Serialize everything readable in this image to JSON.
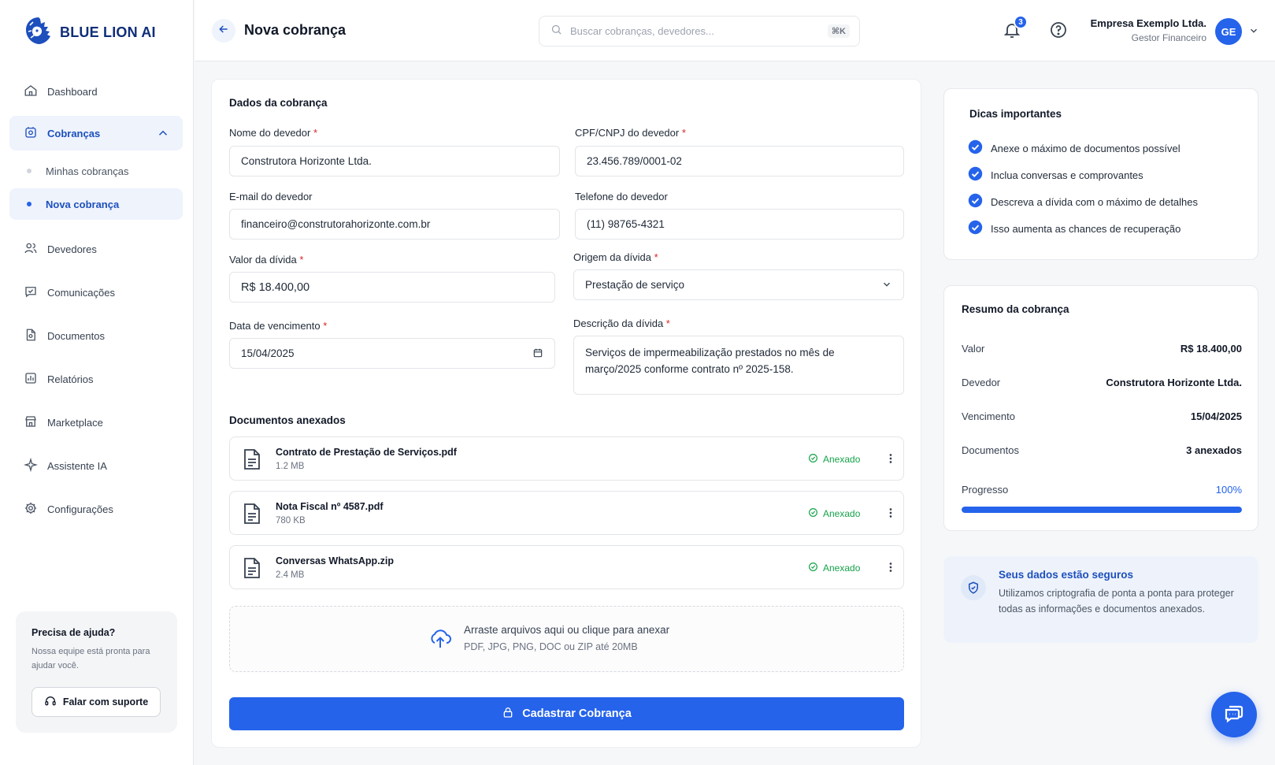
{
  "brand": {
    "name": "BLUE LION AI"
  },
  "sidebar": {
    "items": [
      {
        "label": "Dashboard"
      },
      {
        "label": "Cobranças"
      },
      {
        "label": "Devedores"
      },
      {
        "label": "Comunicações"
      },
      {
        "label": "Documentos"
      },
      {
        "label": "Relatórios"
      },
      {
        "label": "Marketplace"
      },
      {
        "label": "Assistente IA"
      },
      {
        "label": "Configurações"
      }
    ],
    "subitems": [
      {
        "label": "Minhas cobranças"
      },
      {
        "label": "Nova cobrança"
      }
    ],
    "help": {
      "title": "Precisa de ajuda?",
      "text": "Nossa equipe está pronta para ajudar você.",
      "button": "Falar com suporte"
    }
  },
  "header": {
    "title": "Nova cobrança",
    "search_placeholder": "Buscar cobranças, devedores...",
    "search_shortcut": "⌘K",
    "notifications_count": "3",
    "company_name": "Empresa Exemplo Ltda.",
    "company_role": "Gestor Financeiro",
    "avatar_initials": "GE"
  },
  "form": {
    "section_title": "Dados da cobrança",
    "debtor_name": {
      "label": "Nome do devedor",
      "value": "Construtora Horizonte Ltda."
    },
    "document": {
      "label": "CPF/CNPJ do devedor",
      "value": "23.456.789/0001-02"
    },
    "email": {
      "label": "E-mail do devedor",
      "value": "financeiro@construtorahorizonte.com.br"
    },
    "phone": {
      "label": "Telefone do devedor",
      "value": "(11) 98765-4321"
    },
    "amount": {
      "label": "Valor da dívida",
      "value": "R$ 18.400,00"
    },
    "origin": {
      "label": "Origem da dívida",
      "value": "Prestação de serviço"
    },
    "due_date": {
      "label": "Data de vencimento",
      "value": "15/04/2025"
    },
    "description": {
      "label": "Descrição da dívida",
      "value": "Serviços de impermeabilização prestados no mês de março/2025 conforme contrato nº 2025-158."
    },
    "required_mark": "*"
  },
  "documents": {
    "title": "Documentos anexados",
    "items": [
      {
        "name": "Contrato de Prestação de Serviços.pdf",
        "size": "1.2 MB",
        "status": "Anexado"
      },
      {
        "name": "Nota Fiscal nº 4587.pdf",
        "size": "780 KB",
        "status": "Anexado"
      },
      {
        "name": "Conversas WhatsApp.zip",
        "size": "2.4 MB",
        "status": "Anexado"
      }
    ],
    "dropzone_title": "Arraste arquivos aqui ou clique para anexar",
    "dropzone_sub": "PDF, JPG, PNG, DOC ou ZIP até 20MB"
  },
  "submit_label": "Cadastrar Cobrança",
  "tips": {
    "title": "Dicas importantes",
    "items": [
      "Anexe o máximo de documentos possível",
      "Inclua conversas e comprovantes",
      "Descreva a dívida com o máximo de detalhes",
      "Isso aumenta as chances de recuperação"
    ]
  },
  "summary": {
    "title": "Resumo da cobrança",
    "rows": [
      {
        "label": "Valor",
        "value": "R$ 18.400,00"
      },
      {
        "label": "Devedor",
        "value": "Construtora Horizonte Ltda."
      },
      {
        "label": "Vencimento",
        "value": "15/04/2025"
      },
      {
        "label": "Documentos",
        "value": "3 anexados"
      }
    ],
    "progress_label": "Progresso",
    "progress_value": "100%",
    "progress_fraction": 1.0
  },
  "secure": {
    "title": "Seus dados estão seguros",
    "text": "Utilizamos criptografia de ponta a ponta para proteger todas as informações e documentos anexados."
  },
  "colors": {
    "primary": "#2563eb",
    "brand": "#0f2e78",
    "success": "#16a34a",
    "required": "#dc2626"
  },
  "icons": [
    "lion-logo-icon",
    "home-icon",
    "wallet-icon",
    "users-icon",
    "chat-check-icon",
    "document-icon",
    "chart-icon",
    "store-icon",
    "sparkle-icon",
    "gear-icon",
    "headset-icon",
    "arrow-left-icon",
    "search-icon",
    "bell-icon",
    "question-icon",
    "chevron-down-icon",
    "calendar-icon",
    "file-icon",
    "check-circle-icon",
    "more-vertical-icon",
    "upload-cloud-icon",
    "lock-icon",
    "shield-check-icon",
    "chat-bubble-icon"
  ]
}
